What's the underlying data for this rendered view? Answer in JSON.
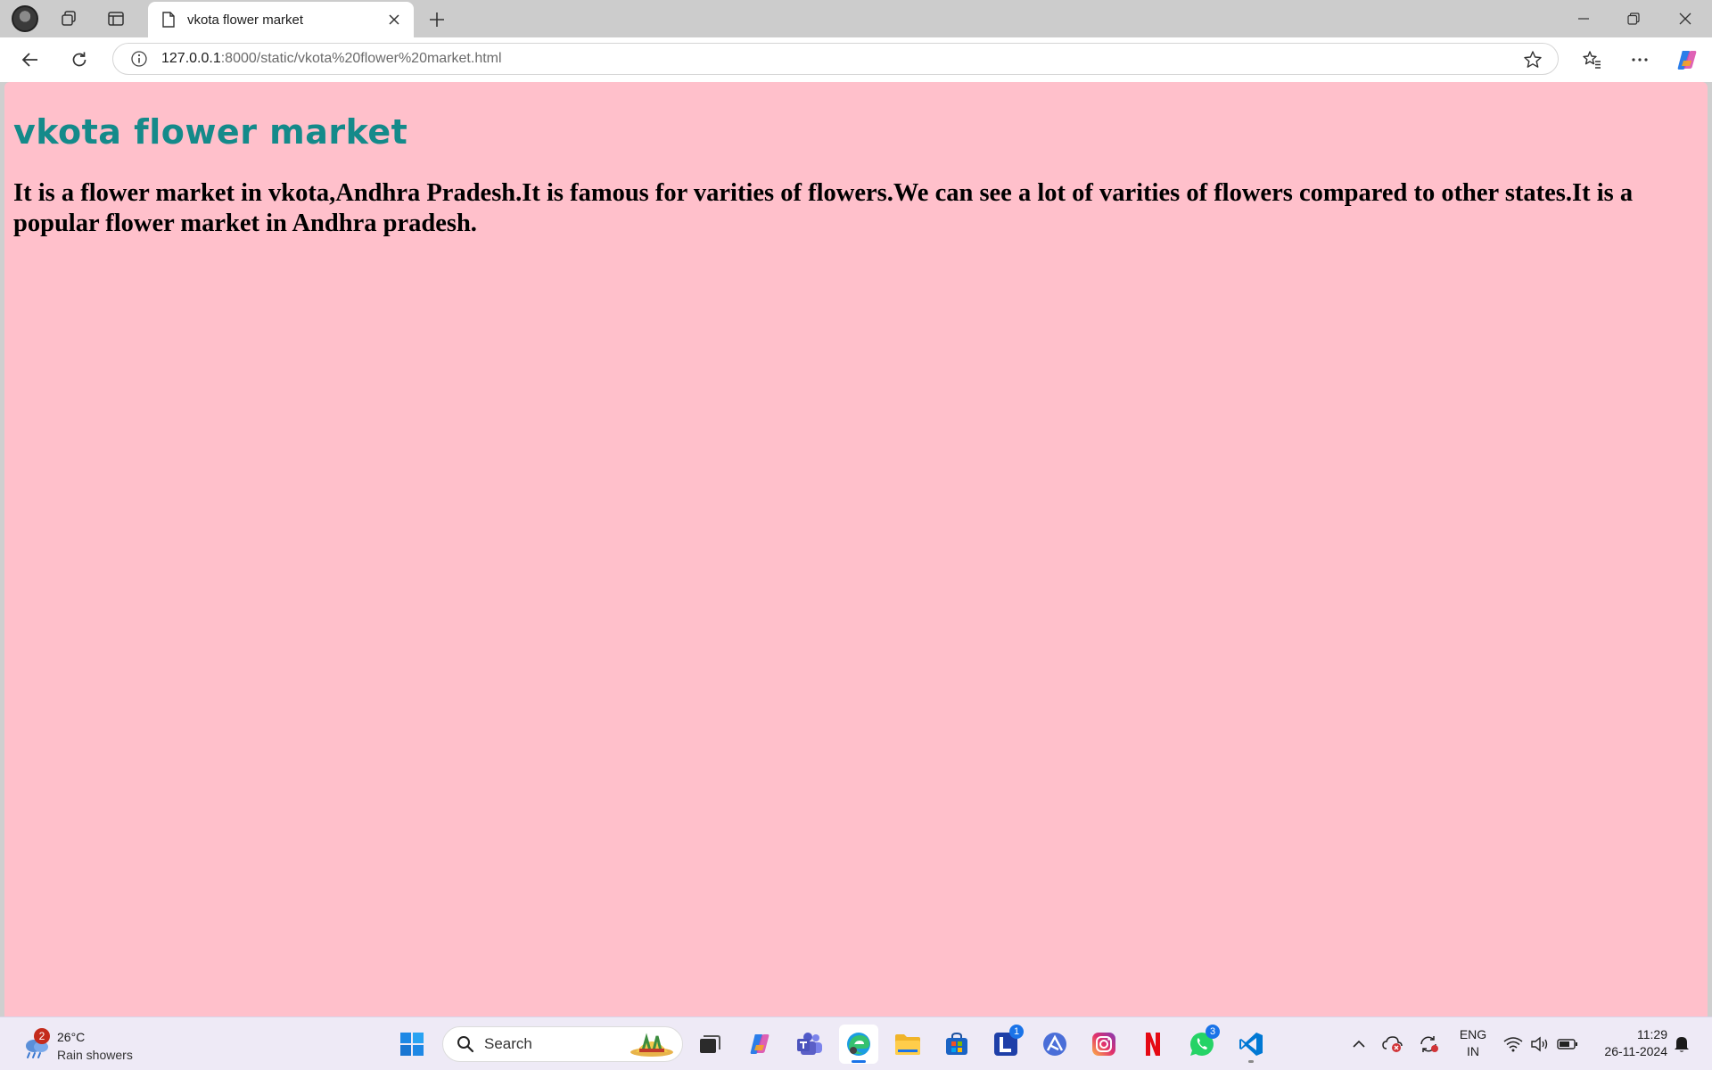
{
  "browser": {
    "tab": {
      "title": "vkota flower market"
    },
    "address": {
      "host": "127.0.0.1",
      "rest": ":8000/static/vkota%20flower%20market.html"
    }
  },
  "page": {
    "heading": "vkota flower market",
    "heading_color": "#148a8a",
    "background_color": "#ffc0cb",
    "paragraph": "It is a flower market in vkota,Andhra Pradesh.It is famous for varities of flowers.We can see a lot of varities of flowers compared to other states.It is a popular flower market in Andhra pradesh."
  },
  "taskbar": {
    "weather": {
      "badge": "2",
      "temp": "26°C",
      "condition": "Rain showers"
    },
    "search_label": "Search",
    "apps": [
      {
        "name": "start-icon"
      },
      {
        "name": "task-view-icon"
      },
      {
        "name": "copilot-icon"
      },
      {
        "name": "teams-icon"
      },
      {
        "name": "edge-icon",
        "active": true
      },
      {
        "name": "file-explorer-icon"
      },
      {
        "name": "store-icon"
      },
      {
        "name": "l-app-icon",
        "badge": "1"
      },
      {
        "name": "vector-app-icon"
      },
      {
        "name": "instagram-icon"
      },
      {
        "name": "netflix-icon"
      },
      {
        "name": "whatsapp-icon",
        "badge": "3"
      },
      {
        "name": "vscode-icon"
      }
    ],
    "language": {
      "line1": "ENG",
      "line2": "IN"
    },
    "clock": {
      "time": "11:29",
      "date": "26-11-2024"
    }
  }
}
